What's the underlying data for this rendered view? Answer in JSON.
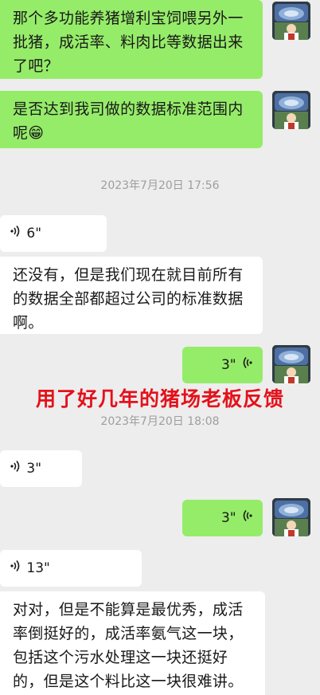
{
  "messages": {
    "m1": "那个多功能养猪增利宝饲喂另外一批猪，成活率、料肉比等数据出来了吧？",
    "m2": "是否达到我司做的数据标准范围内呢😁",
    "m3": "还没有，但是我们现在就目前所有的数据全部都超过公司的标准数据啊。",
    "m4": "对对，但是不能算是最优秀，成活率倒挺好的，成活率氨气这一块，包括这个污水处理这一块还挺好的，但是这个料比这一块很难讲。"
  },
  "timestamps": {
    "t1": "2023年7月20日 17:56",
    "t2": "2023年7月20日 18:08"
  },
  "voices": {
    "v1": "6\"",
    "v2": "3\"",
    "v3": "3\"",
    "v4": "3\"",
    "v5": "13\""
  },
  "overlay_caption": "用了好几年的猪场老板反馈",
  "colors": {
    "outgoing_bubble": "#95ec69",
    "incoming_bubble": "#ffffff",
    "background": "#ededed",
    "caption_red": "#e4111b"
  }
}
